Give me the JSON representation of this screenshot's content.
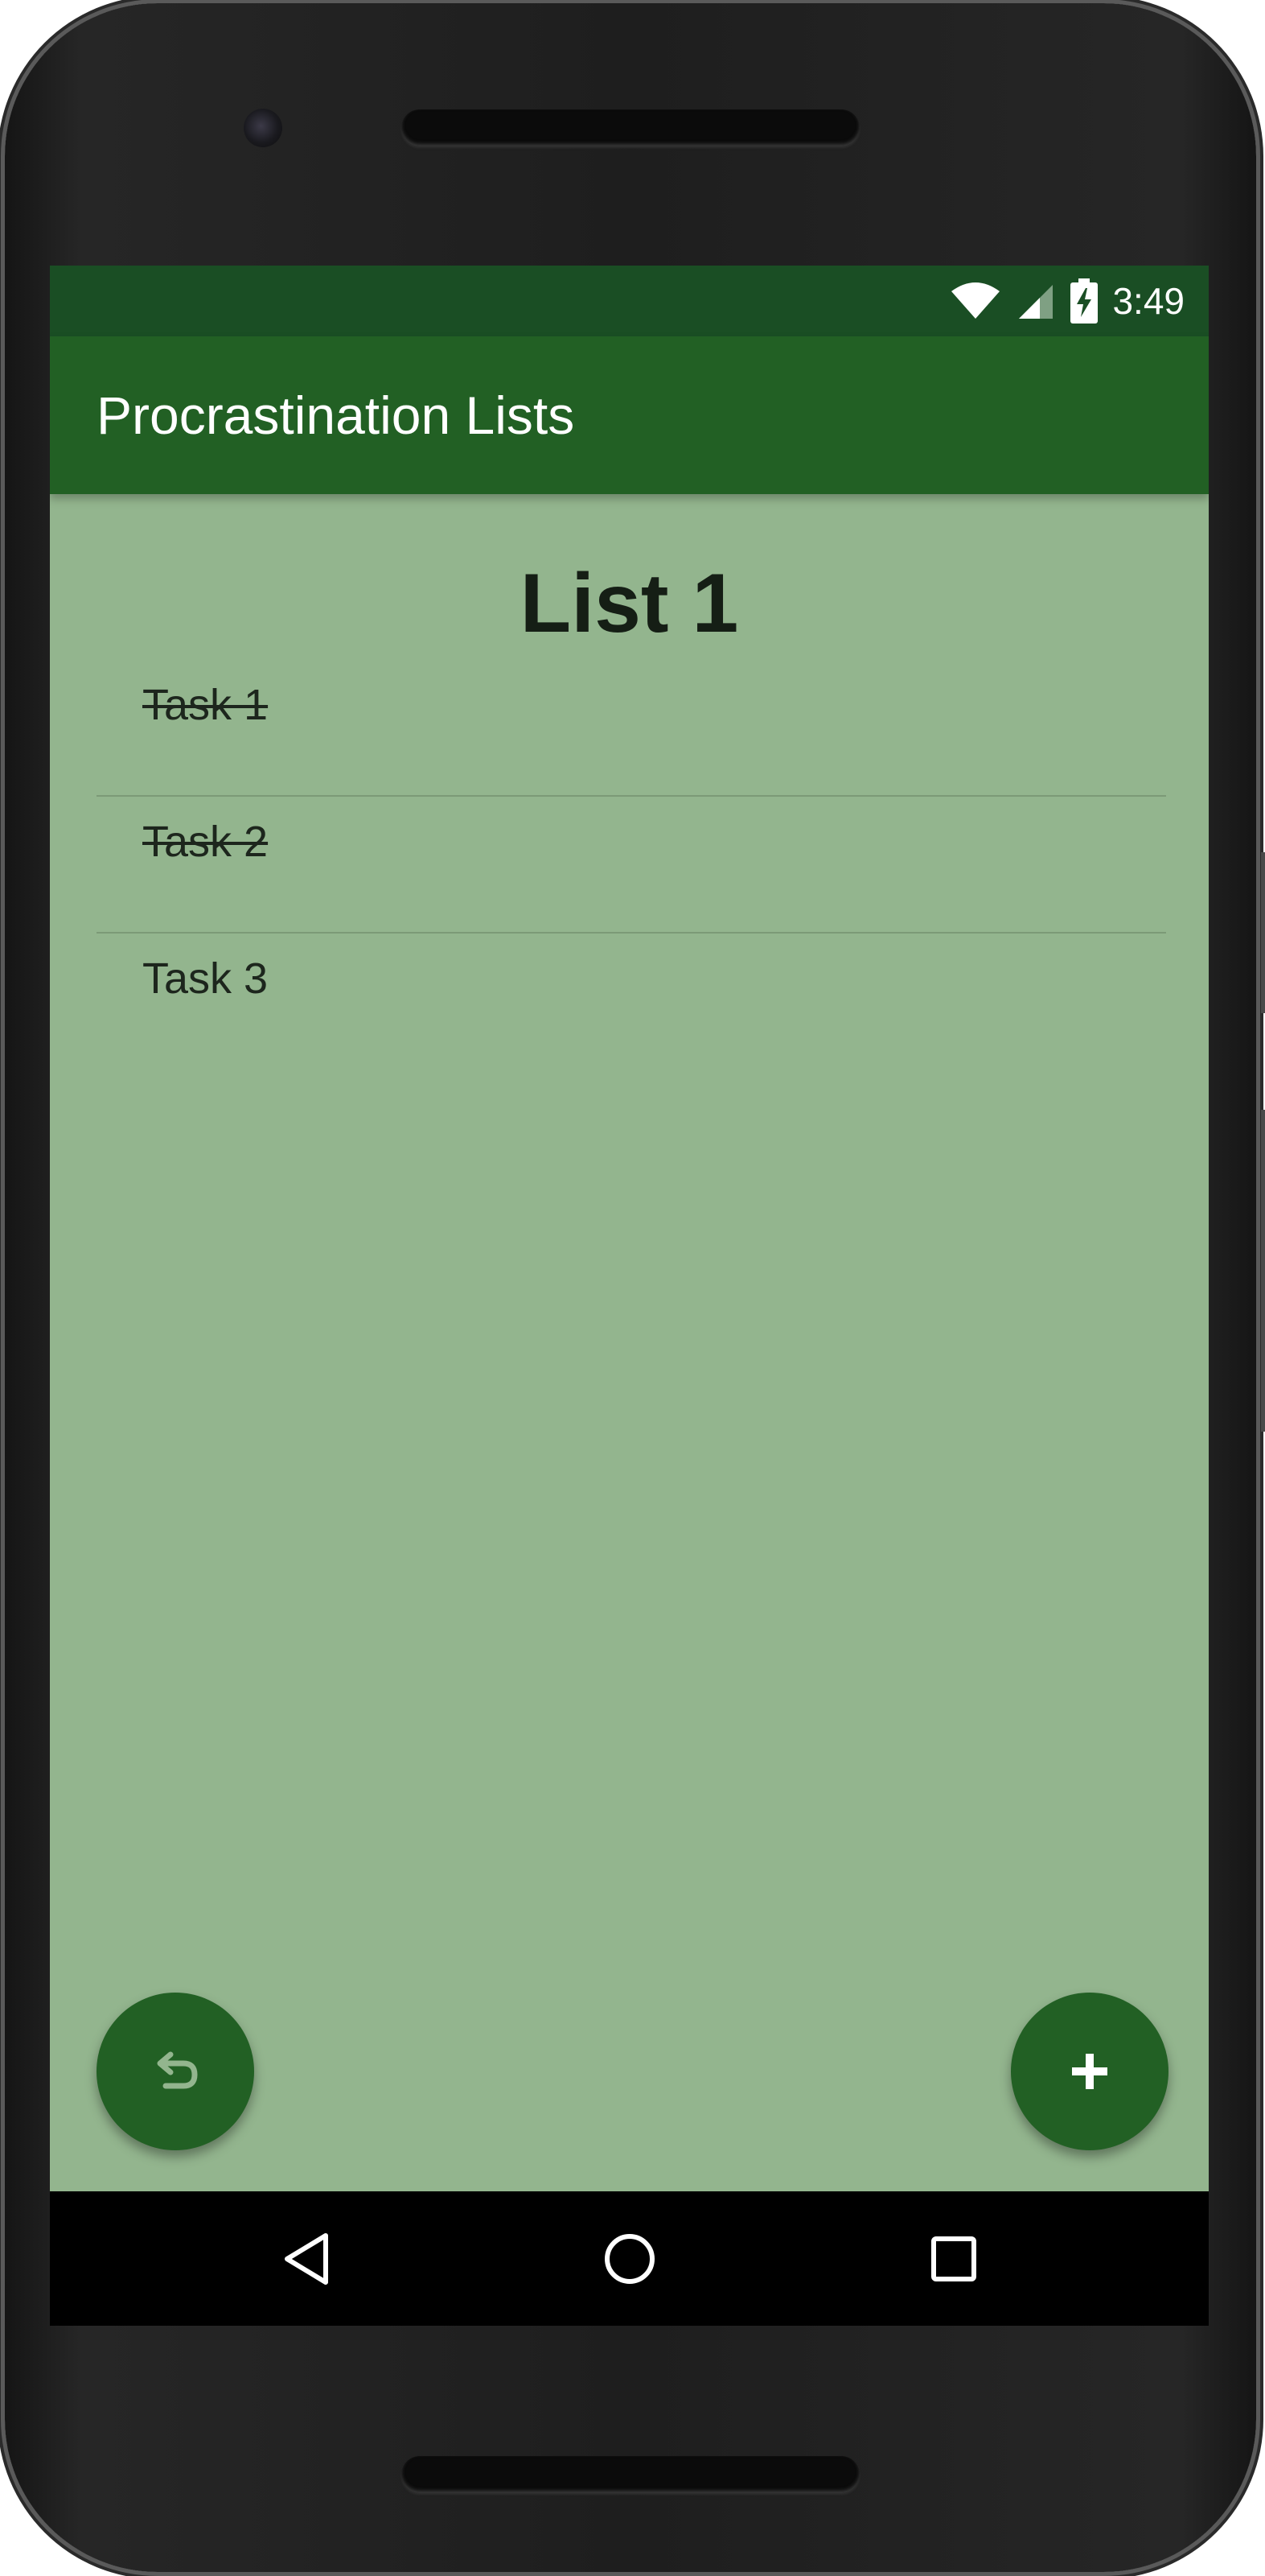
{
  "status_bar": {
    "time": "3:49",
    "icons": [
      "wifi-icon",
      "cell-signal-icon",
      "battery-charging-icon"
    ]
  },
  "app_bar": {
    "title": "Procrastination Lists",
    "color": "#226024"
  },
  "list": {
    "title": "List 1",
    "tasks": [
      {
        "label": "Task 1",
        "done": true
      },
      {
        "label": "Task 2",
        "done": true
      },
      {
        "label": "Task 3",
        "done": false
      }
    ]
  },
  "actions": {
    "undo_icon": "undo-icon",
    "add_icon": "plus-icon"
  },
  "nav_bar": {
    "icons": [
      "back-icon",
      "home-icon",
      "recents-icon"
    ]
  },
  "colors": {
    "background": "#93b58e",
    "status_bar": "#1a4e24",
    "accent": "#226024"
  }
}
